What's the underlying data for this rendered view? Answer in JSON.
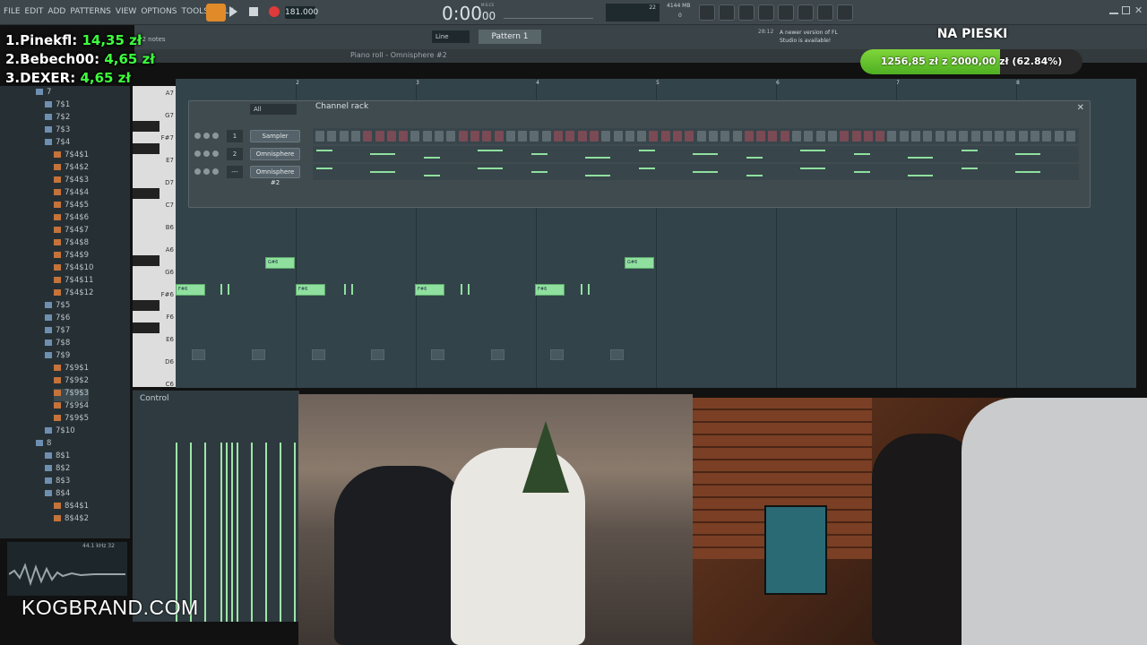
{
  "menu": [
    "FILE",
    "EDIT",
    "ADD",
    "PATTERNS",
    "VIEW",
    "OPTIONS",
    "TOOLS",
    "HELP"
  ],
  "transport": {
    "tempo": "181.000",
    "time": "0:00",
    "time_sub": "00",
    "time_label": "M:S:CS",
    "cpu": "22",
    "mem": "4144 MB",
    "poly": "0",
    "pattern": "Pattern 1",
    "snap": "Line"
  },
  "notes_count": "22 notes",
  "update_notice": {
    "time": "28:12",
    "text": "A newer version of FL Studio is available!"
  },
  "piano_roll_title": "Piano roll - Omnisphere #2",
  "channel_rack": {
    "title": "Channel rack",
    "filter": "All",
    "channels": [
      {
        "num": "1",
        "name": "Sampler"
      },
      {
        "num": "2",
        "name": "Omnisphere"
      },
      {
        "num": "---",
        "name": "Omnisphere #2"
      }
    ]
  },
  "control_label": "Control",
  "donations": [
    {
      "rank": "1.",
      "name": "Pinekfl:",
      "amount": "14,35 zł"
    },
    {
      "rank": "2.",
      "name": "Bebech00:",
      "amount": "4,65 zł"
    },
    {
      "rank": "3.",
      "name": "DEXER:",
      "amount": "4,65 zł"
    }
  ],
  "goal": {
    "title": "NA PIESKI",
    "text": "1256,85 zł z 2000,00 zł (62.84%)",
    "progress": 0.6284
  },
  "key_labels": [
    "A7",
    "G7",
    "F#7",
    "E7",
    "D7",
    "C7",
    "B6",
    "A6",
    "G6",
    "F#6",
    "F6",
    "E6",
    "D6",
    "C6",
    "B5"
  ],
  "bar_numbers": [
    "2",
    "3",
    "4",
    "5",
    "6",
    "7",
    "8"
  ],
  "browser_items": [
    "7",
    "7$1",
    "7$2",
    "7$3",
    "7$4",
    "7$4$1",
    "7$4$2",
    "7$4$3",
    "7$4$4",
    "7$4$5",
    "7$4$6",
    "7$4$7",
    "7$4$8",
    "7$4$9",
    "7$4$10",
    "7$4$11",
    "7$4$12",
    "7$5",
    "7$6",
    "7$7",
    "7$8",
    "7$9",
    "7$9$1",
    "7$9$2",
    "7$9$3",
    "7$9$4",
    "7$9$5",
    "7$10",
    "8",
    "8$1",
    "8$2",
    "8$3",
    "8$4",
    "8$4$1",
    "8$4$2"
  ],
  "waveform_info": "44.1 kHz 32",
  "watermark": "KOGBRAND.COM",
  "notes_label": [
    "G#6",
    "F#6",
    "F#6",
    "F#6",
    "F#6",
    "G#6"
  ],
  "colors": {
    "accent": "#3dff3d",
    "note": "#8fe09e",
    "goal": "#5fc22a"
  }
}
